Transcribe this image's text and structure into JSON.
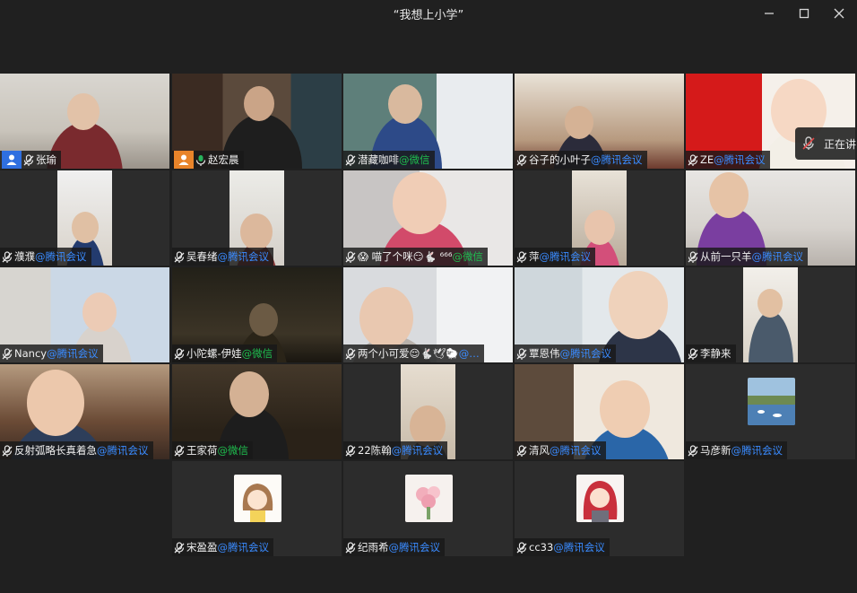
{
  "window": {
    "title": "“我想上小学”",
    "speaking_text": "正在讲"
  },
  "participants": [
    {
      "name": "张瑜",
      "suffix": "",
      "host": true
    },
    {
      "name": "赵宏晨",
      "suffix": "",
      "host": true
    },
    {
      "name": "潜藏咖啡",
      "suffix": "@微信"
    },
    {
      "name": "谷子的小叶子",
      "suffix": "@腾讯会议"
    },
    {
      "name": "ZE",
      "suffix": "@腾讯会议"
    },
    {
      "name": "濮濮",
      "suffix": "@腾讯会议"
    },
    {
      "name": "吴春绪",
      "suffix": "@腾讯会议"
    },
    {
      "name": "😱 喵了个咪😏🐇 ⁶⁶⁶",
      "suffix": "@微信"
    },
    {
      "name": "萍",
      "suffix": "@腾讯会议"
    },
    {
      "name": "从前一只羊",
      "suffix": "@腾讯会议"
    },
    {
      "name": "Nancy",
      "suffix": "@腾讯会议"
    },
    {
      "name": "小陀螺-伊娃",
      "suffix": "@微信"
    },
    {
      "name": "两个小可爱😌🐇🕊🐑",
      "suffix": "@…"
    },
    {
      "name": "覃恩伟",
      "suffix": "@腾讯会议"
    },
    {
      "name": "李静来",
      "suffix": ""
    },
    {
      "name": "反射弧略长真着急",
      "suffix": "@腾讯会议"
    },
    {
      "name": "王家荷",
      "suffix": "@微信"
    },
    {
      "name": "22陈翰",
      "suffix": "@腾讯会议"
    },
    {
      "name": "清风",
      "suffix": "@腾讯会议"
    },
    {
      "name": "马彦新",
      "suffix": "@腾讯会议"
    },
    {
      "name": "宋盈盈",
      "suffix": "@腾讯会议"
    },
    {
      "name": "纪雨希",
      "suffix": "@腾讯会议"
    },
    {
      "name": "cc33",
      "suffix": "@腾讯会议"
    }
  ],
  "colors": {
    "background": "#202020",
    "tile": "#2c2c2c",
    "active_border": "#27b35c",
    "wechat": "#1fbf4f",
    "tencent_meeting": "#3a8bff",
    "host_blue": "#2f6fe0",
    "host_orange": "#e8842a",
    "mic_muted": "#e8e8e8"
  }
}
